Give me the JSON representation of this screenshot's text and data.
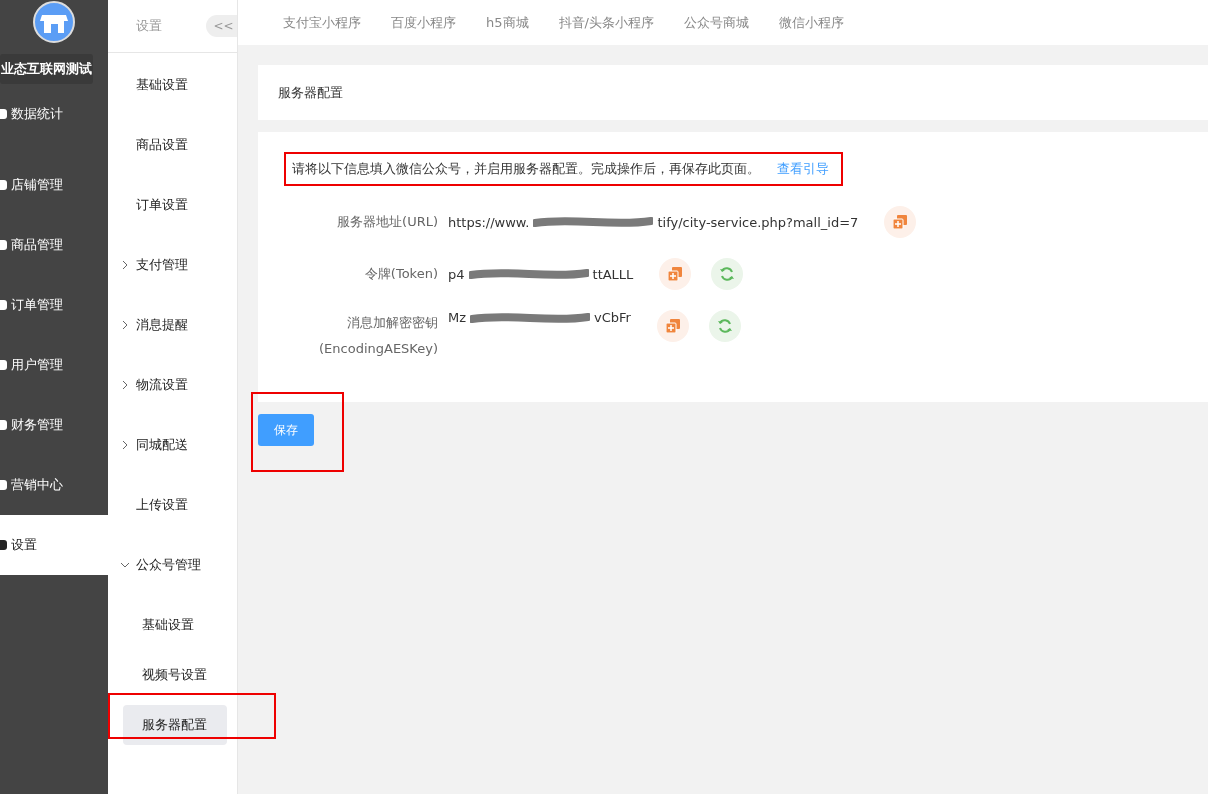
{
  "sidebar": {
    "store_name": "业态互联网测试",
    "items": [
      {
        "label": "数据统计",
        "selected": false
      },
      {
        "label": "店铺管理",
        "selected": false
      },
      {
        "label": "商品管理",
        "selected": false
      },
      {
        "label": "订单管理",
        "selected": false
      },
      {
        "label": "用户管理",
        "selected": false
      },
      {
        "label": "财务管理",
        "selected": false
      },
      {
        "label": "营销中心",
        "selected": false
      },
      {
        "label": "设置",
        "selected": true
      }
    ]
  },
  "submenu": {
    "title": "设置",
    "collapse": "<<",
    "items": [
      {
        "label": "基础设置"
      },
      {
        "label": "商品设置"
      },
      {
        "label": "订单设置"
      },
      {
        "label": "支付管理",
        "expanded": false
      },
      {
        "label": "消息提醒",
        "expanded": false
      },
      {
        "label": "物流设置",
        "expanded": false
      },
      {
        "label": "同城配送",
        "expanded": false
      },
      {
        "label": "上传设置"
      },
      {
        "label": "公众号管理",
        "expanded": true,
        "children": [
          {
            "label": "基础设置",
            "selected": false
          },
          {
            "label": "视频号设置",
            "selected": false
          },
          {
            "label": "服务器配置",
            "selected": true
          }
        ]
      }
    ]
  },
  "tabs": [
    {
      "label": "支付宝小程序"
    },
    {
      "label": "百度小程序"
    },
    {
      "label": "h5商城"
    },
    {
      "label": "抖音/头条小程序"
    },
    {
      "label": "公众号商城"
    },
    {
      "label": "微信小程序"
    }
  ],
  "page_title": "服务器配置",
  "notice": {
    "text": "请将以下信息填入微信公众号，并启用服务器配置。完成操作后，再保存此页面。",
    "link": "查看引导"
  },
  "fields": [
    {
      "label": "服务器地址(URL)",
      "value_start": "https://www.",
      "value_end": "tify/city-service.php?mall_id=7",
      "refresh": false
    },
    {
      "label": "令牌(Token)",
      "value_start": "p4",
      "value_end": "ttALLL",
      "refresh": true
    },
    {
      "label": "消息加解密密钥",
      "label_2": "(EncodingAESKey)",
      "value_start": "Mz",
      "value_end": "vCbFr",
      "refresh": true
    }
  ],
  "save_button": "保存"
}
